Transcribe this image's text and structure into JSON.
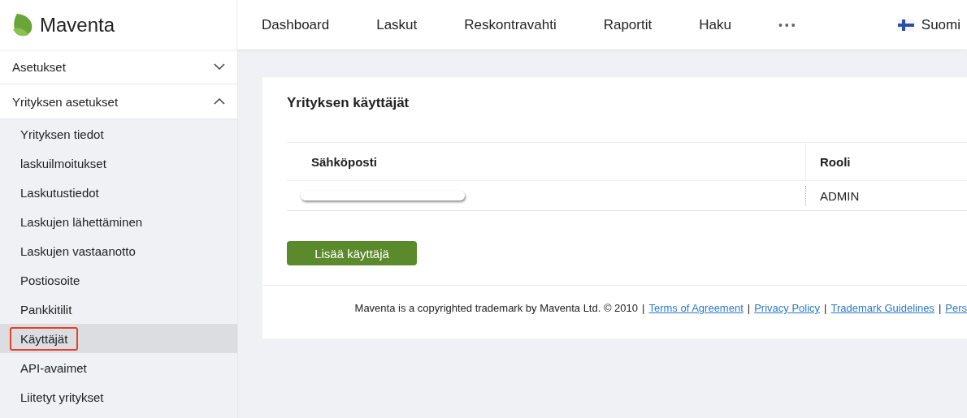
{
  "header": {
    "logo": "Maventa",
    "nav": [
      "Dashboard",
      "Laskut",
      "Reskontravahti",
      "Raportit",
      "Haku"
    ],
    "more": "•••",
    "language": "Suomi"
  },
  "sidebar": {
    "groups": [
      {
        "label": "Asetukset",
        "expanded": false
      },
      {
        "label": "Yrityksen asetukset",
        "expanded": true,
        "items": [
          {
            "label": "Yrityksen tiedot",
            "selected": false
          },
          {
            "label": "laskuilmoitukset",
            "selected": false
          },
          {
            "label": "Laskutustiedot",
            "selected": false
          },
          {
            "label": "Laskujen lähettäminen",
            "selected": false
          },
          {
            "label": "Laskujen vastaanotto",
            "selected": false
          },
          {
            "label": "Postiosoite",
            "selected": false
          },
          {
            "label": "Pankkitilit",
            "selected": false
          },
          {
            "label": "Käyttäjät",
            "selected": true
          },
          {
            "label": "API-avaimet",
            "selected": false
          },
          {
            "label": "Liitetyt yritykset",
            "selected": false
          }
        ]
      }
    ]
  },
  "card": {
    "title": "Yrityksen käyttäjät",
    "table": {
      "columns": [
        "Sähköposti",
        "Rooli"
      ],
      "rows": [
        {
          "role": "ADMIN"
        }
      ]
    },
    "add_button": "Lisää käyttäjä"
  },
  "footer": {
    "parts": [
      {
        "kind": "text",
        "text": "Maventa is a copyrighted trademark by Maventa Ltd. © 2010"
      },
      {
        "kind": "separator",
        "text": "|"
      },
      {
        "kind": "link",
        "text": "Terms of Agreement"
      },
      {
        "kind": "separator",
        "text": "|"
      },
      {
        "kind": "link",
        "text": "Privacy Policy"
      },
      {
        "kind": "separator",
        "text": "|"
      },
      {
        "kind": "link",
        "text": "Trademark Guidelines"
      },
      {
        "kind": "separator",
        "text": "|"
      },
      {
        "kind": "link",
        "text": "Pers"
      }
    ]
  }
}
